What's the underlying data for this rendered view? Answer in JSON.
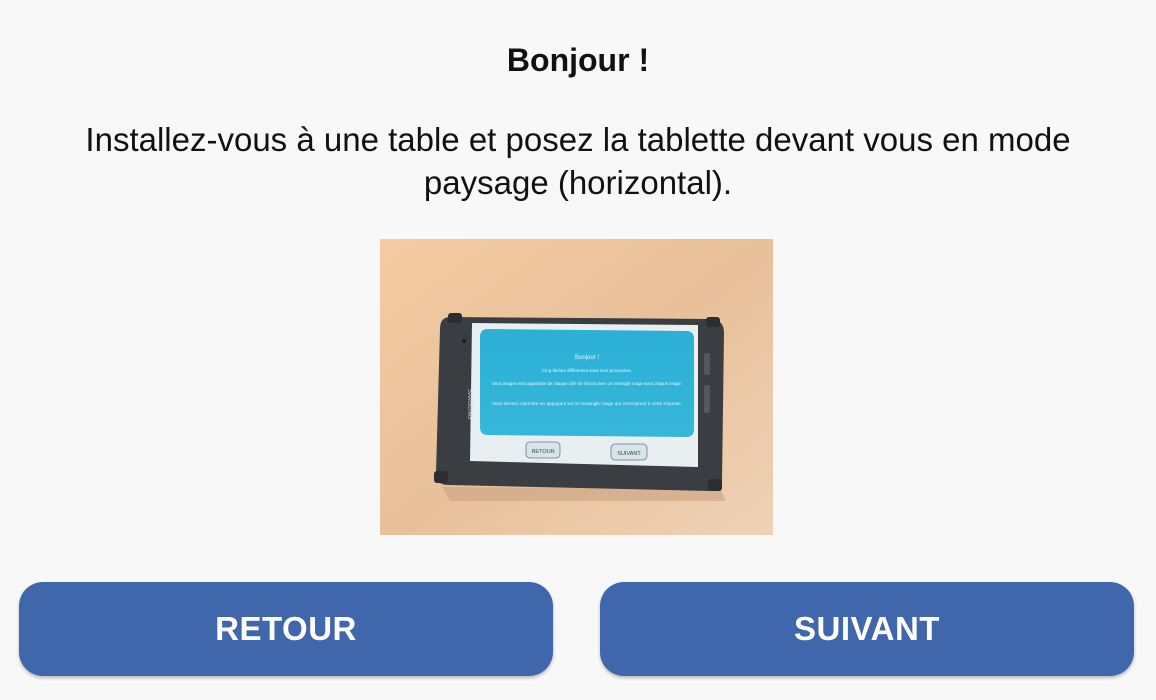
{
  "screen": {
    "title": "Bonjour !",
    "instructions": "Installez-vous à une table et posez la tablette devant vous en mode paysage (horizontal).",
    "photo": {
      "tablet_brand": "SAMSUNG",
      "inner_screen": {
        "title": "Bonjour !",
        "line1": "Cinq tâches différentes vous sont proposées.",
        "line2": "Deux images vont apparaître de chaque côté de l'écran avec un rectangle rouge sous chaque image.",
        "line3": "Vous devrez répondre en appuyant sur le rectangle rouge qui correspond à votre réponse.",
        "back_label": "RETOUR",
        "next_label": "SUIVANT"
      }
    }
  },
  "buttons": {
    "back_label": "RETOUR",
    "next_label": "SUIVANT"
  },
  "colors": {
    "background": "#f8f8f8",
    "button": "#4066ac",
    "button_text": "#ffffff",
    "text": "#111111"
  }
}
